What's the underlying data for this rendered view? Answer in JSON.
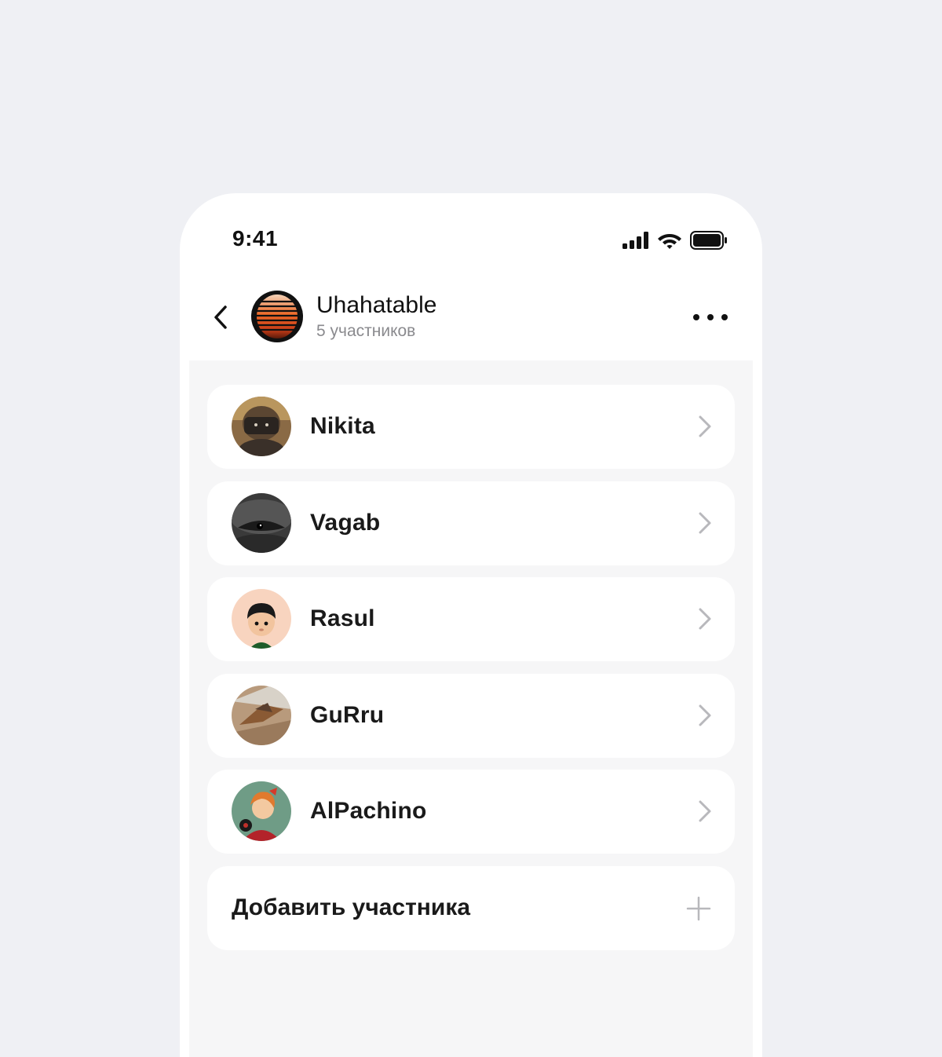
{
  "status_bar": {
    "time": "9:41",
    "icons": [
      "signal-icon",
      "wifi-icon",
      "battery-icon"
    ]
  },
  "header": {
    "title": "Uhahatable",
    "subtitle": "5 участников",
    "icons": [
      "back-arrow-icon",
      "group-avatar",
      "more-dots-icon"
    ]
  },
  "members": [
    {
      "name": "Nikita",
      "avatar": "avatar-photo"
    },
    {
      "name": "Vagab",
      "avatar": "avatar-photo"
    },
    {
      "name": "Rasul",
      "avatar": "avatar-photo"
    },
    {
      "name": "GuRru",
      "avatar": "avatar-photo"
    },
    {
      "name": "AlPachino",
      "avatar": "avatar-photo"
    }
  ],
  "add_member": {
    "label": "Добавить участника",
    "icon": "plus-icon"
  },
  "colors": {
    "page_background": "#eff0f4",
    "card_background": "#ffffff",
    "list_background": "#f6f6f7",
    "text_primary": "#1a1a1a",
    "text_secondary": "#8a8a8e",
    "chevron": "#b8b8bc"
  }
}
